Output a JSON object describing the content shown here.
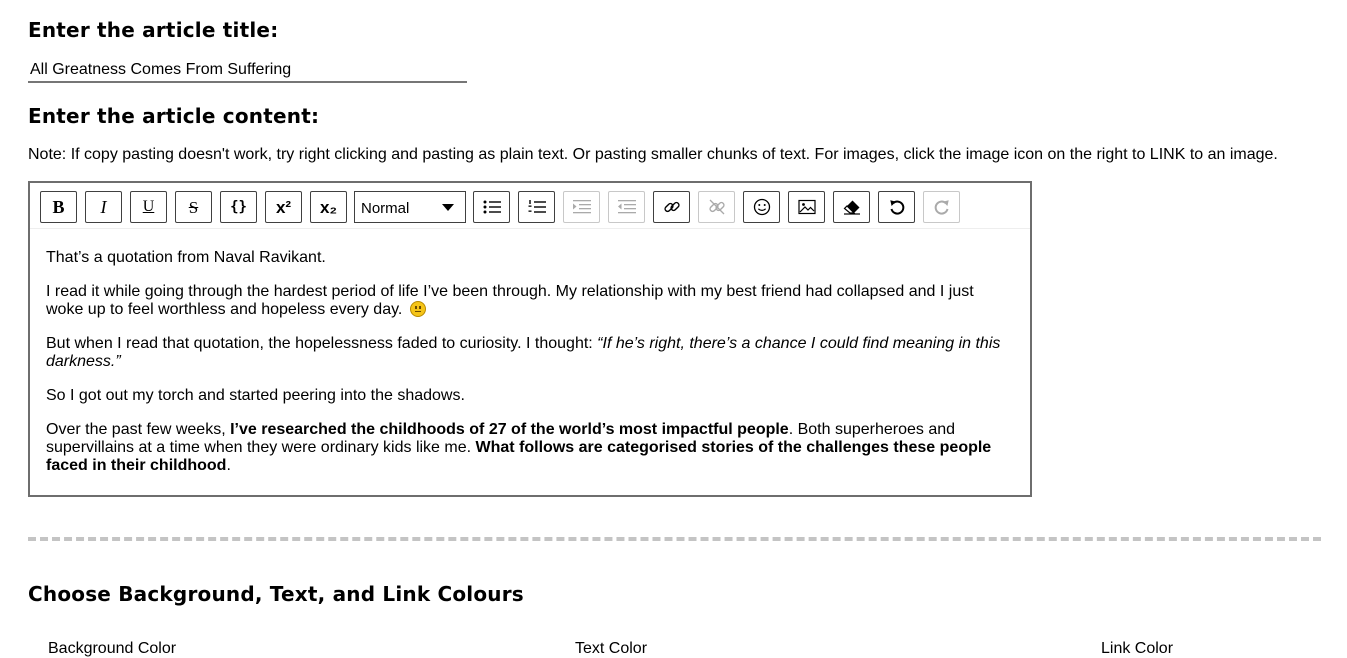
{
  "title_section": {
    "heading": "Enter the article title:",
    "input_value": "All Greatness Comes From Suffering"
  },
  "content_section": {
    "heading": "Enter the article content:",
    "note": "Note: If copy pasting doesn't work, try right clicking and pasting as plain text. Or pasting smaller chunks of text. For images, click the image icon on the right to LINK to an image."
  },
  "toolbar": {
    "bold": "B",
    "italic": "I",
    "underline": "U",
    "strike": "S",
    "code": "{}",
    "superscript": "x²",
    "subscript": "x₂",
    "format_select_value": "Normal",
    "disabled_buttons": [
      "indent",
      "outdent",
      "unlink",
      "redo"
    ]
  },
  "editor_content": {
    "p1": "That’s a quotation from Naval Ravikant.",
    "p2": "I read it while going through the hardest period of life I’ve been through. My relationship with my best friend had collapsed and I just woke up to feel worthless and hopeless every day.",
    "p2_emoji": "neutral-face-emoji",
    "p3_start": "But when I read that quotation, the hopelessness faded to curiosity. I thought: ",
    "p3_italic": "“If he’s right, there’s a chance I could find meaning in this darkness.”",
    "p4": "So I got out my torch and started peering into the shadows.",
    "p5_start": "Over the past few weeks, ",
    "p5_bold1": "I’ve researched the childhoods of 27 of the world’s most impactful people",
    "p5_mid": ". Both superheroes and supervillains at a time when they were ordinary kids like me. ",
    "p5_bold2": "What follows are categorised stories of the challenges these people faced in their childhood",
    "p5_end": "."
  },
  "colors_section": {
    "heading": "Choose Background, Text, and Link Colours",
    "background_label": "Background Color",
    "text_label": "Text Color",
    "link_label": "Link Color"
  },
  "colors": {
    "border": "#6e6e6e",
    "divider": "#c4c4c4",
    "emoji": "#f5c418"
  }
}
